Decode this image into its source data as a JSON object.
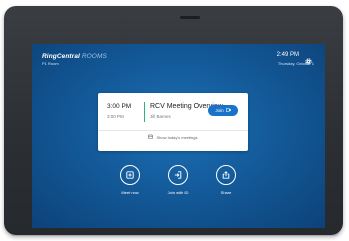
{
  "header": {
    "brand": "RingCentral",
    "brand_suffix": "ROOMS",
    "room_name": "P1 Room",
    "time": "2:49 PM",
    "date": "Thursday, October 1",
    "settings_icon": "gear-icon"
  },
  "meeting_card": {
    "start_time": "3:00 PM",
    "end_time": "3:00 PM",
    "title": "RCV Meeting Overview",
    "host": "Jill Barnes",
    "join_label": "Join",
    "join_icon": "video-camera-icon",
    "accent_color": "#2bb673",
    "show_meetings_label": "Show today's meetings",
    "show_meetings_icon": "calendar-icon"
  },
  "actions": [
    {
      "label": "Meet now",
      "icon": "plus-square-icon"
    },
    {
      "label": "Join with ID",
      "icon": "enter-icon"
    },
    {
      "label": "Share",
      "icon": "share-upload-icon"
    }
  ],
  "colors": {
    "screen_background": "#1564a8",
    "join_button": "#1a73c9",
    "device_bezel": "#2f3237"
  }
}
